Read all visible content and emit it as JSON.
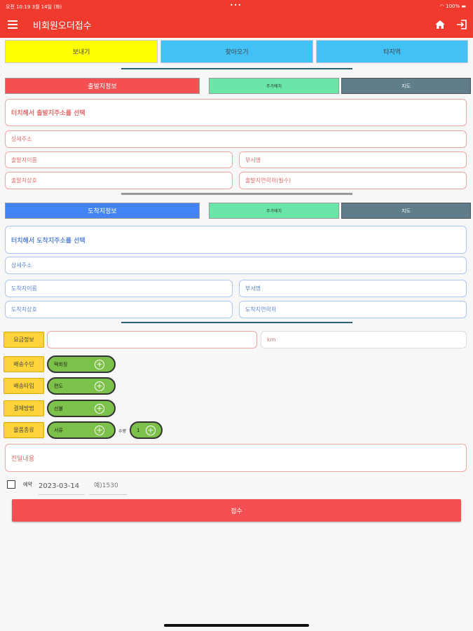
{
  "status_bar": {
    "time": "오전 10:19",
    "date": "3월 14일 (화)",
    "battery": "100%"
  },
  "app_bar": {
    "title": "비회원오더접수",
    "left_icon": "menu-icon",
    "right_icons": [
      "home-icon",
      "exit-icon"
    ]
  },
  "tabs": [
    {
      "label": "보내기",
      "color": "#ffff00"
    },
    {
      "label": "찾아오기",
      "color": "#41c1f5"
    },
    {
      "label": "타지역",
      "color": "#41c1f5"
    }
  ],
  "origin": {
    "title": "출발지정보",
    "title_color": "#f44f52",
    "add_label": "주가배치",
    "map_label": "지도",
    "address_select": "터치해서 출발지주소를 선택",
    "detail_address": "상세주소",
    "name": "출발지이름",
    "department": "부서명",
    "company": "출발지상호",
    "contact": "출발지연락처(필수)"
  },
  "destination": {
    "title": "도착지정보",
    "title_color": "#4284f5",
    "add_label": "주가배치",
    "map_label": "지도",
    "address_select": "터치해서 도착지주소를 선택",
    "detail_address": "상세주소",
    "name": "도착지이름",
    "department": "부서명",
    "company": "도착지상호",
    "contact": "도착지연락처"
  },
  "fare": {
    "label": "요금정보",
    "unit": "km"
  },
  "options": [
    {
      "label": "배송수단",
      "value": "택회정"
    },
    {
      "label": "배송타입",
      "value": "편도"
    },
    {
      "label": "결제방법",
      "value": "선불"
    },
    {
      "label": "물품종류",
      "value": "서류"
    }
  ],
  "quantity": {
    "label": "수량",
    "value": "1"
  },
  "memo": {
    "placeholder": "전달내용"
  },
  "reservation": {
    "label": "예약",
    "date": "2023-03-14",
    "time_placeholder": "예)1530"
  },
  "submit_label": "접수"
}
